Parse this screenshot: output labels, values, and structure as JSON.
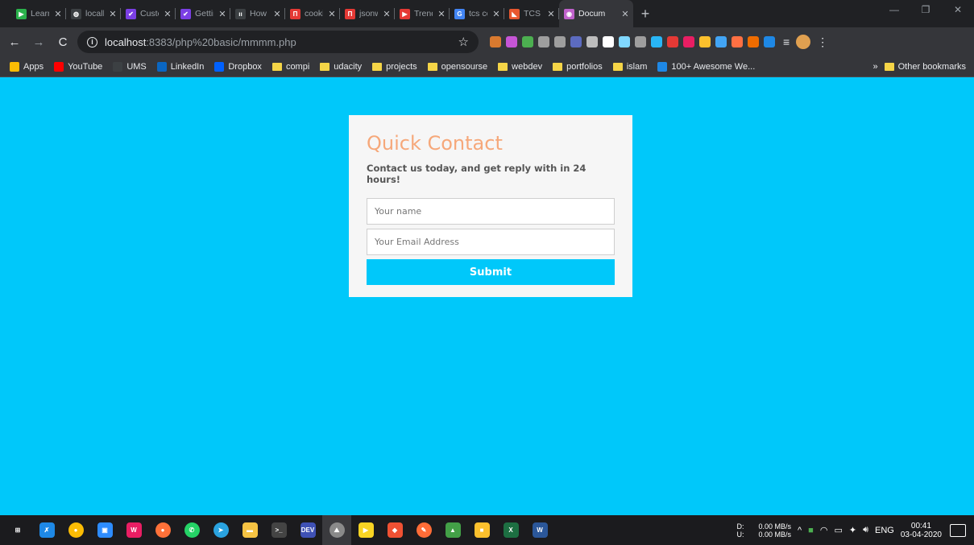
{
  "browser": {
    "tabs": [
      {
        "title": "LearnC",
        "color": "#2bb24c",
        "glyph": "▶"
      },
      {
        "title": "localho",
        "color": "#3c4043",
        "glyph": "◍"
      },
      {
        "title": "Custom",
        "color": "#7b3fe4",
        "glyph": "✔"
      },
      {
        "title": "Getting",
        "color": "#7b3fe4",
        "glyph": "✔"
      },
      {
        "title": "How to",
        "color": "#3c4043",
        "glyph": "ıı"
      },
      {
        "title": "cookie",
        "color": "#e53935",
        "glyph": "Π"
      },
      {
        "title": "jsonwe",
        "color": "#e53935",
        "glyph": "Π"
      },
      {
        "title": "Trendin",
        "color": "#e53935",
        "glyph": "▶"
      },
      {
        "title": "tcs cod",
        "color": "#4285f4",
        "glyph": "G"
      },
      {
        "title": "TCS Co",
        "color": "#e8572f",
        "glyph": "◣"
      },
      {
        "title": "Docum",
        "color": "#c061cb",
        "glyph": "◉",
        "active": true
      }
    ],
    "new_tab": "+",
    "window_controls": {
      "minimize": "—",
      "restore": "❐",
      "close": "✕"
    },
    "address": {
      "host": "localhost",
      "path": ":8383/php%20basic/mmmm.php"
    },
    "extensions": [
      "#d97a2f",
      "#c655d6",
      "#4caf50",
      "#9e9e9e",
      "#9e9e9e",
      "#5c6bc0",
      "#bdbdbd",
      "#ffffff",
      "#80d8ff",
      "#9e9e9e",
      "#29b6f6",
      "#e53935",
      "#e91e63",
      "#fbc02d",
      "#42a5f5",
      "#ff7043",
      "#ef6c00",
      "#1e88e5"
    ],
    "bookmarks": [
      {
        "label": "Apps",
        "icon": "apps-icon",
        "color": "#fbbc04"
      },
      {
        "label": "YouTube",
        "icon": "youtube-icon",
        "color": "#ff0000"
      },
      {
        "label": "UMS",
        "icon": "globe-icon",
        "color": "#3c4043"
      },
      {
        "label": "LinkedIn",
        "icon": "linkedin-icon",
        "color": "#0a66c2"
      },
      {
        "label": "Dropbox",
        "icon": "dropbox-icon",
        "color": "#0061ff"
      },
      {
        "label": "compi",
        "icon": "folder-icon"
      },
      {
        "label": "udacity",
        "icon": "folder-icon"
      },
      {
        "label": "projects",
        "icon": "folder-icon"
      },
      {
        "label": "opensourse",
        "icon": "folder-icon"
      },
      {
        "label": "webdev",
        "icon": "folder-icon"
      },
      {
        "label": "portfolios",
        "icon": "folder-icon"
      },
      {
        "label": "islam",
        "icon": "folder-icon"
      },
      {
        "label": "100+ Awesome We...",
        "icon": "site-icon",
        "color": "#1e88e5"
      }
    ],
    "bookmarks_overflow": "»",
    "other_bookmarks": "Other bookmarks"
  },
  "page": {
    "background": "#00c8fa",
    "form": {
      "title": "Quick Contact",
      "subtitle": "Contact us today, and get reply with in 24 hours!",
      "name_placeholder": "Your name",
      "email_placeholder": "Your Email Address",
      "submit_label": "Submit",
      "title_color": "#f6a87a",
      "button_color": "#00c8fa"
    }
  },
  "taskbar": {
    "apps": [
      {
        "name": "windows-start-icon",
        "color": "#ffffff",
        "glyph": "⊞"
      },
      {
        "name": "vscode-icon",
        "color": "#1e88e5",
        "glyph": "✗"
      },
      {
        "name": "chrome-icon",
        "color": "#fbbc04",
        "glyph": "●",
        "round": true
      },
      {
        "name": "zoom-icon",
        "color": "#2d8cff",
        "glyph": "▣"
      },
      {
        "name": "wamp-icon",
        "color": "#e91e63",
        "glyph": "W"
      },
      {
        "name": "firefox-icon",
        "color": "#ff7139",
        "glyph": "●",
        "round": true
      },
      {
        "name": "whatsapp-icon",
        "color": "#25d366",
        "glyph": "✆",
        "round": true
      },
      {
        "name": "telegram-icon",
        "color": "#2aa3e0",
        "glyph": "➤",
        "round": true
      },
      {
        "name": "file-explorer-icon",
        "color": "#f6c343",
        "glyph": "▬"
      },
      {
        "name": "terminal-icon",
        "color": "#444444",
        "glyph": ">_"
      },
      {
        "name": "dev-icon",
        "color": "#3f51b5",
        "glyph": "DEV"
      },
      {
        "name": "photos-icon",
        "color": "#8a8a8a",
        "glyph": "⛰",
        "round": true
      },
      {
        "name": "sticky-icon",
        "color": "#f9d423",
        "glyph": "▶"
      },
      {
        "name": "git-icon",
        "color": "#f05133",
        "glyph": "◆"
      },
      {
        "name": "postman-icon",
        "color": "#ff6c37",
        "glyph": "✎",
        "round": true
      },
      {
        "name": "rocket-icon",
        "color": "#43a047",
        "glyph": "▲"
      },
      {
        "name": "notes-icon",
        "color": "#fbc02d",
        "glyph": "■"
      },
      {
        "name": "excel-icon",
        "color": "#1d6f42",
        "glyph": "X"
      },
      {
        "name": "word-icon",
        "color": "#2b579a",
        "glyph": "W"
      }
    ],
    "net_labels": {
      "down": "D:",
      "up": "U:"
    },
    "net_values": {
      "down": "0.00 MB/s",
      "up": "0.00 MB/s"
    },
    "language": "ENG",
    "time": "00:41",
    "date": "03-04-2020"
  }
}
